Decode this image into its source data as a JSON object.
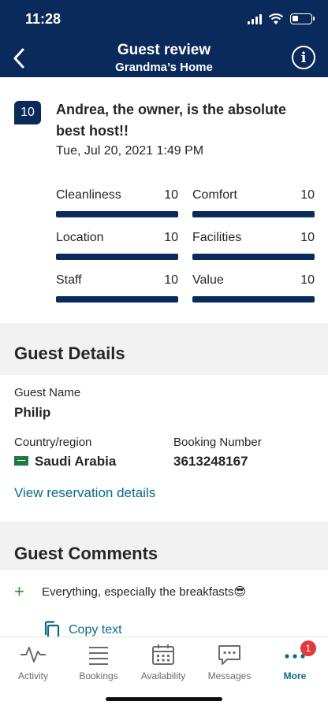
{
  "status": {
    "time": "11:28"
  },
  "header": {
    "title": "Guest review",
    "subtitle": "Grandma’s Home"
  },
  "review": {
    "score": "10",
    "title": "Andrea, the owner, is the absolute best host!!",
    "date": "Tue, Jul 20, 2021 1:49 PM",
    "ratings": [
      {
        "label": "Cleanliness",
        "value": "10",
        "fraction": 1.0
      },
      {
        "label": "Comfort",
        "value": "10",
        "fraction": 1.0
      },
      {
        "label": "Location",
        "value": "10",
        "fraction": 1.0
      },
      {
        "label": "Facilities",
        "value": "10",
        "fraction": 1.0
      },
      {
        "label": "Staff",
        "value": "10",
        "fraction": 1.0
      },
      {
        "label": "Value",
        "value": "10",
        "fraction": 1.0
      }
    ]
  },
  "guest_details": {
    "heading": "Guest Details",
    "name_label": "Guest Name",
    "name": "Philip",
    "country_label": "Country/region",
    "country": "Saudi Arabia",
    "booking_label": "Booking Number",
    "booking_number": "3613248167",
    "view_link": "View reservation details"
  },
  "guest_comments": {
    "heading": "Guest Comments",
    "comment": "Everything, especially the breakfasts😎",
    "copy_label": "Copy text"
  },
  "tabs": [
    {
      "label": "Activity",
      "icon": "activity-icon"
    },
    {
      "label": "Bookings",
      "icon": "list-icon"
    },
    {
      "label": "Availability",
      "icon": "calendar-icon"
    },
    {
      "label": "Messages",
      "icon": "message-icon"
    },
    {
      "label": "More",
      "icon": "more-icon",
      "badge": "1",
      "active": true
    }
  ],
  "colors": {
    "brand": "#0b2a5c",
    "link": "#0b6a8a",
    "badge": "#e0393e"
  }
}
